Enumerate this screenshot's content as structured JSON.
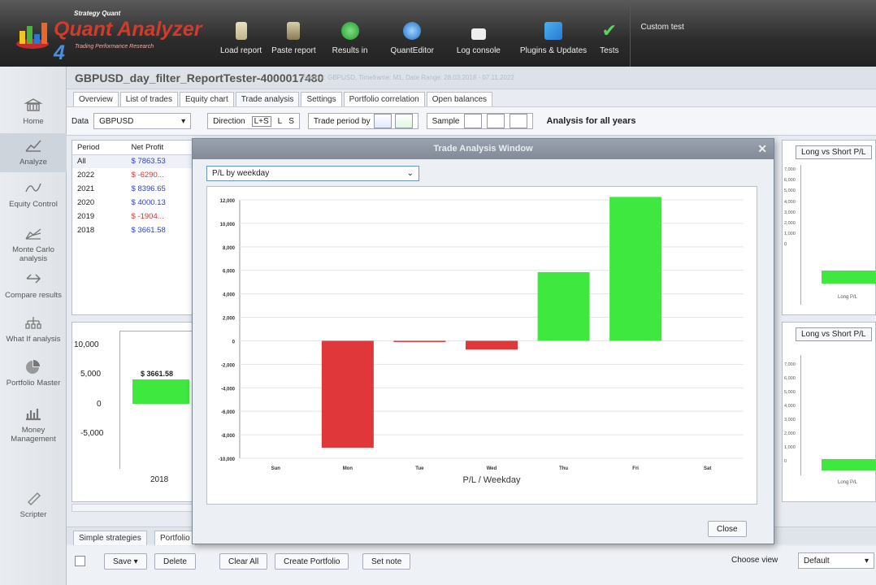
{
  "toolbar": {
    "brand_top": "Strategy Quant",
    "brand_main": "Quant Analyzer",
    "brand_version": "4",
    "brand_sub": "Trading Performance    Research",
    "buttons": [
      {
        "label": "Load report",
        "icon": "load-report-icon"
      },
      {
        "label": "Paste report",
        "icon": "paste-report-icon"
      },
      {
        "label": "Results in",
        "icon": "results-icon"
      },
      {
        "label": "QuantEditor",
        "icon": "quanteditor-icon"
      },
      {
        "label": "Log console",
        "icon": "log-console-icon"
      },
      {
        "label": "Plugins & Updates",
        "icon": "plugins-icon"
      },
      {
        "label": "Tests",
        "icon": "check-icon"
      }
    ],
    "custom_test": "Custom test"
  },
  "sidebar": {
    "items": [
      {
        "label": "Home",
        "icon": "home-icon"
      },
      {
        "label": "Analyze",
        "icon": "analyze-icon"
      },
      {
        "label": "Equity Control",
        "icon": "equity-control-icon"
      },
      {
        "label": "Monte Carlo analysis",
        "icon": "monte-carlo-icon"
      },
      {
        "label": "Compare results",
        "icon": "compare-icon"
      },
      {
        "label": "What If analysis",
        "icon": "what-if-icon"
      },
      {
        "label": "Portfolio Master",
        "icon": "portfolio-icon"
      },
      {
        "label": "Money Management",
        "icon": "money-management-icon"
      },
      {
        "label": "Scripter",
        "icon": "scripter-icon"
      }
    ]
  },
  "header": {
    "title": "GBPUSD_day_filter_ReportTester-4000017480",
    "meta": "Symbol: GBPUSD, Timeframe: M1, Date Range: 28.03.2018 - 07.11.2022"
  },
  "tabs": [
    "Overview",
    "List of trades",
    "Equity chart",
    "Trade analysis",
    "Settings",
    "Portfolio correlation",
    "Open balances"
  ],
  "active_tab": "Trade analysis",
  "filter": {
    "data_label": "Data",
    "data_value": "GBPUSD",
    "direction_label": "Direction",
    "directions": [
      "L+S",
      "L",
      "S"
    ],
    "trade_period_label": "Trade period by",
    "trade_period_icons": [
      "open time",
      "close time"
    ],
    "sample_label": "Sample",
    "analysis_label": "Analysis for all years"
  },
  "period_table": {
    "headers": [
      "Period",
      "Net Profit"
    ],
    "rows": [
      {
        "period": "All",
        "profit": "$ 7863.53",
        "sign": "pos"
      },
      {
        "period": "2022",
        "profit": "$ -6290...",
        "sign": "neg"
      },
      {
        "period": "2021",
        "profit": "$ 8396.65",
        "sign": "pos"
      },
      {
        "period": "2020",
        "profit": "$ 4000.13",
        "sign": "pos"
      },
      {
        "period": "2019",
        "profit": "$ -1904...",
        "sign": "neg"
      },
      {
        "period": "2018",
        "profit": "$ 3661.58",
        "sign": "pos"
      }
    ]
  },
  "year_chart": {
    "yticks": [
      "10,000",
      "5,000",
      "0",
      "-5,000"
    ],
    "bar_label": "$ 3661.58",
    "xlabel": "2018"
  },
  "right_panels": {
    "title": "Long vs Short P/L",
    "yticks": [
      "7,000",
      "6,000",
      "5,000",
      "4,000",
      "3,000",
      "2,000",
      "1,000",
      "0"
    ],
    "xlabel": "Long P/L"
  },
  "modal": {
    "title": "Trade Analysis Window",
    "dropdown_value": "P/L by weekday",
    "close_label": "Close"
  },
  "chart_data": {
    "type": "bar",
    "categories": [
      "Sun",
      "Mon",
      "Tue",
      "Wed",
      "Thu",
      "Fri",
      "Sat"
    ],
    "values": [
      0,
      -9100,
      -50,
      -750,
      5850,
      12250,
      0
    ],
    "ylim": [
      -10000,
      12000
    ],
    "yticks": [
      12000,
      10000,
      8000,
      6000,
      4000,
      2000,
      0,
      -2000,
      -4000,
      -6000,
      -8000,
      -10000
    ],
    "ytick_labels": [
      "12,000",
      "10,000",
      "8,000",
      "6,000",
      "4,000",
      "2,000",
      "0",
      "-2,000",
      "-4,000",
      "-6,000",
      "-8,000",
      "-10,000"
    ],
    "xlabel": "P/L / Weekday",
    "positive_color": "#3ee83e",
    "negative_color": "#e0373a",
    "grid": true
  },
  "bottom": {
    "tabs": [
      "Simple strategies",
      "Portfolio"
    ],
    "buttons": [
      "Save",
      "Delete",
      "Clear All",
      "Create Portfolio",
      "Set note"
    ],
    "choose_view_label": "Choose view",
    "choose_view_value": "Default"
  }
}
